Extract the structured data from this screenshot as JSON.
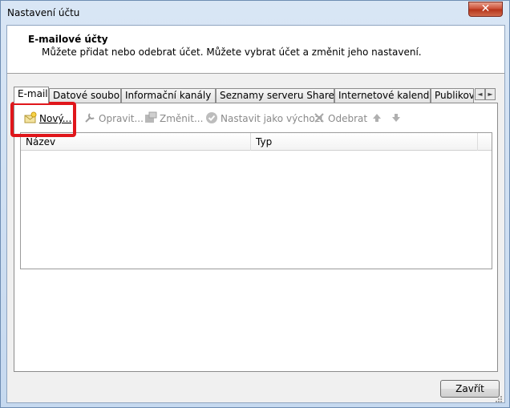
{
  "window": {
    "title": "Nastavení účtu",
    "close_glyph": "✕"
  },
  "header": {
    "title": "E-mailové účty",
    "description": "Můžete přidat nebo odebrat účet. Můžete vybrat účet a změnit jeho nastavení."
  },
  "tabs": [
    {
      "label": "E-mail",
      "active": true
    },
    {
      "label": "Datové soubory"
    },
    {
      "label": "Informační kanály RSS"
    },
    {
      "label": "Seznamy serveru SharePoint"
    },
    {
      "label": "Internetové kalendáře"
    },
    {
      "label": "Publikované kalendáře"
    }
  ],
  "tab_scroll": {
    "left": "◄",
    "right": "►"
  },
  "toolbar": {
    "new_label": "Nový...",
    "repair_label": "Opravit...",
    "change_label": "Změnit...",
    "set_default_label": "Nastavit jako výchozí",
    "remove_label": "Odebrat",
    "icons": {
      "new": "new-account-icon",
      "repair": "repair-icon",
      "change": "change-icon",
      "set_default": "check-icon",
      "remove": "remove-x-icon",
      "up": "arrow-up-icon",
      "down": "arrow-down-icon"
    }
  },
  "list": {
    "columns": [
      "Název",
      "Typ"
    ],
    "rows": []
  },
  "footer": {
    "close_label": "Zavřít"
  },
  "colors": {
    "highlight": "#e0161b",
    "title_bar": "#c6d9ef"
  }
}
